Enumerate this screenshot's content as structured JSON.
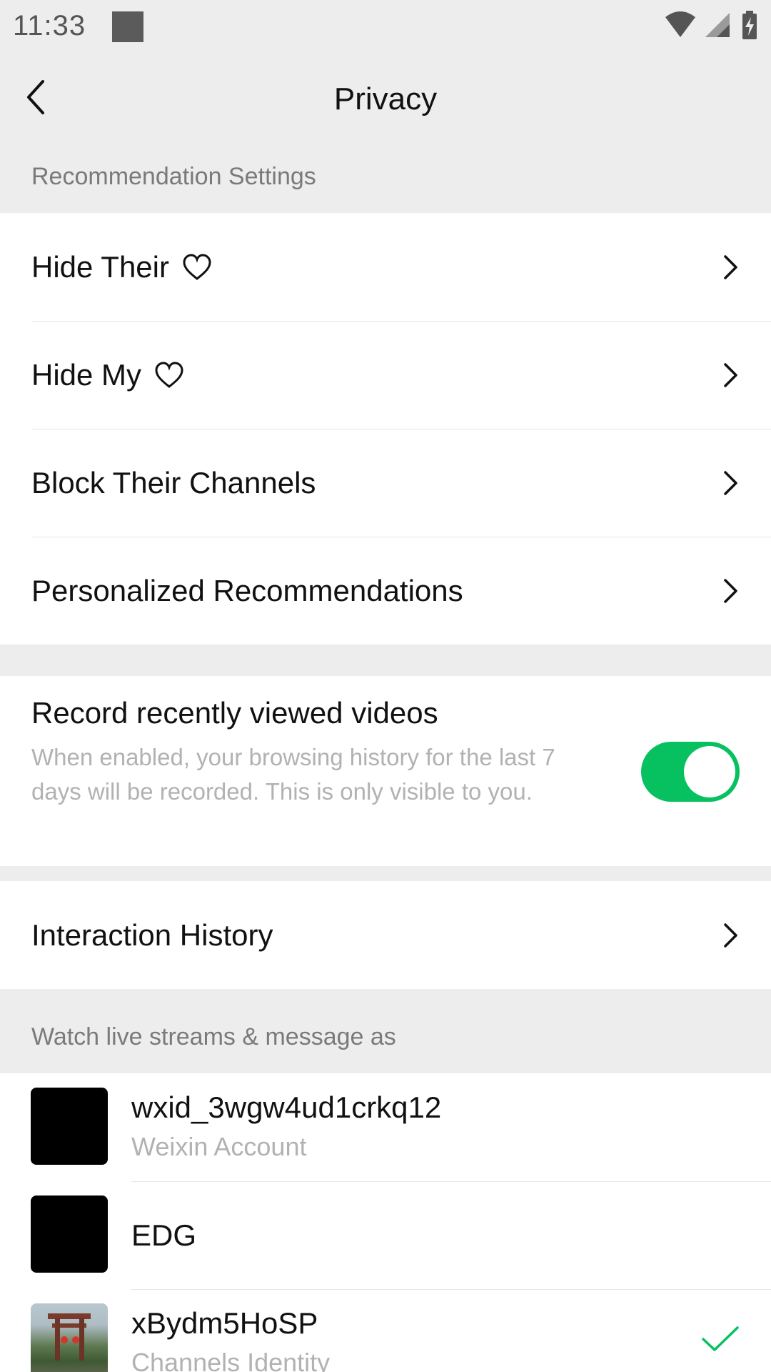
{
  "status_bar": {
    "time": "11:33",
    "icons": [
      "wifi-icon",
      "cell-signal-icon",
      "battery-charging-icon"
    ]
  },
  "nav": {
    "title": "Privacy",
    "back_icon": "chevron-left-icon"
  },
  "recommendation": {
    "header": "Recommendation Settings",
    "items": [
      {
        "label": "Hide Their",
        "icon": "heart-outline-icon"
      },
      {
        "label": "Hide My",
        "icon": "heart-outline-icon"
      },
      {
        "label": "Block Their Channels"
      },
      {
        "label": "Personalized Recommendations"
      }
    ]
  },
  "record": {
    "title": "Record recently viewed videos",
    "description": "When enabled, your browsing history for the last 7 days will be recorded. This is only visible to you.",
    "enabled": true
  },
  "interaction": {
    "label": "Interaction History"
  },
  "live": {
    "header": "Watch live streams & message as",
    "accounts": [
      {
        "name": "wxid_3wgw4ud1crkq12",
        "subtitle": "Weixin Account",
        "selected": false
      },
      {
        "name": "EDG",
        "subtitle": "",
        "selected": false
      },
      {
        "name": "xBydm5HoSP",
        "subtitle": "Channels Identity",
        "selected": true
      }
    ]
  },
  "colors": {
    "accent_green": "#07c160",
    "background": "#ededed",
    "secondary_text": "#b2b2b2"
  }
}
